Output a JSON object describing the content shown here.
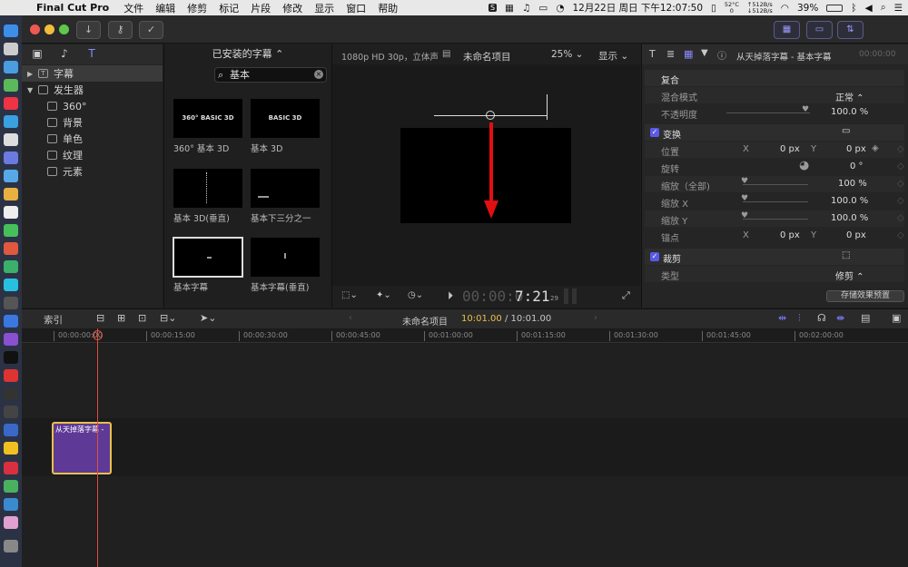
{
  "menubar": {
    "app": "Final Cut Pro",
    "items": [
      "文件",
      "编辑",
      "修剪",
      "标记",
      "片段",
      "修改",
      "显示",
      "窗口",
      "帮助"
    ],
    "temp": "52°C",
    "temp2": "0",
    "net_up": "↑512B/s",
    "net_down": "↓512B/s",
    "battery": "39%",
    "clock": "12月22日 周日 下午12:07:50"
  },
  "library": {
    "tree": [
      {
        "label": "字幕",
        "level": 0,
        "selected": true
      },
      {
        "label": "发生器",
        "level": 0
      },
      {
        "label": "360°",
        "level": 1
      },
      {
        "label": "背景",
        "level": 1
      },
      {
        "label": "单色",
        "level": 1
      },
      {
        "label": "纹理",
        "level": 1
      },
      {
        "label": "元素",
        "level": 1
      }
    ]
  },
  "browser": {
    "header": "已安装的字幕 ⌃",
    "search": "基本",
    "items": [
      {
        "thumb": "360° BASIC 3D",
        "label": "360° 基本 3D"
      },
      {
        "thumb": "BASIC 3D",
        "label": "基本 3D"
      },
      {
        "thumb": "",
        "label": "基本 3D(垂直)"
      },
      {
        "thumb": "",
        "label": "基本下三分之一"
      },
      {
        "thumb": "",
        "label": "基本字幕"
      },
      {
        "thumb": "",
        "label": "基本字幕(垂直)"
      }
    ]
  },
  "viewer": {
    "format": "1080p HD 30p，立体声",
    "project": "未命名项目",
    "zoom": "25%",
    "display": "显示",
    "timecode_dim": "00:00:0",
    "timecode": "7:21",
    "frames": "29"
  },
  "inspector": {
    "title": "从天掉落字幕 - 基本字幕",
    "time": "00:00:00",
    "rows": {
      "composite": "复合",
      "blend_label": "混合模式",
      "blend_value": "正常 ⌃",
      "opacity_label": "不透明度",
      "opacity_value": "100.0 %",
      "transform": "变换",
      "pos_label": "位置",
      "pos_x": "0 px",
      "pos_y": "0 px",
      "rot_label": "旋转",
      "rot_value": "0 °",
      "scale_label": "缩放（全部)",
      "scale_value": "100 %",
      "scalex_label": "缩放 X",
      "scalex_value": "100.0 %",
      "scaley_label": "缩放 Y",
      "scaley_value": "100.0 %",
      "anchor_label": "锚点",
      "anchor_x": "0 px",
      "anchor_y": "0 px",
      "crop": "裁剪",
      "type_label": "类型",
      "type_value": "修剪 ⌃",
      "x": "X",
      "y": "Y"
    },
    "save_preset": "存储效果预置"
  },
  "timeline": {
    "index": "索引",
    "project": "未命名项目",
    "current": "10:01.00",
    "total": "/ 10:01.00",
    "ticks": [
      "00:00:00:00",
      "00:00:15:00",
      "00:00:30:00",
      "00:00:45:00",
      "00:01:00:00",
      "00:01:15:00",
      "00:01:30:00",
      "00:01:45:00",
      "00:02:00:00"
    ],
    "clip_label": "从天掉落字幕 -"
  },
  "colors": {
    "accent": "#5a5ae6",
    "clip": "#5e3a96",
    "clip_border": "#e9c04a",
    "playhead": "#e24c3c",
    "arrow": "#e01010"
  }
}
